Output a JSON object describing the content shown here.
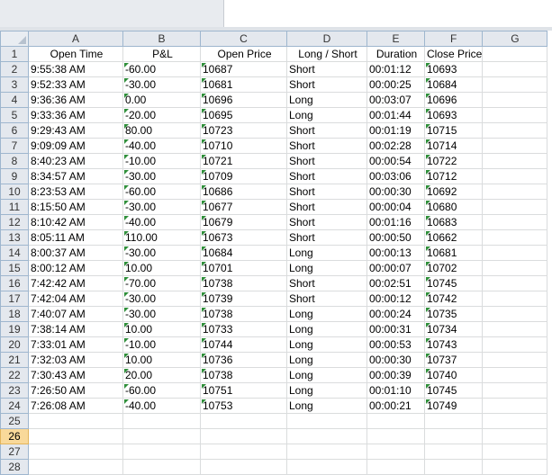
{
  "columns": [
    "A",
    "B",
    "C",
    "D",
    "E",
    "F",
    "G"
  ],
  "headers": [
    "Open Time",
    "P&L",
    "Open Price",
    "Long / Short",
    "Duration",
    "Close Price",
    ""
  ],
  "rows": [
    [
      "9:55:38 AM",
      "-60.00",
      "10687",
      "Short",
      "00:01:12",
      "10693"
    ],
    [
      "9:52:33 AM",
      "-30.00",
      "10681",
      "Short",
      "00:00:25",
      "10684"
    ],
    [
      "9:36:36 AM",
      "0.00",
      "10696",
      "Long",
      "00:03:07",
      "10696"
    ],
    [
      "9:33:36 AM",
      "-20.00",
      "10695",
      "Long",
      "00:01:44",
      "10693"
    ],
    [
      "9:29:43 AM",
      "80.00",
      "10723",
      "Short",
      "00:01:19",
      "10715"
    ],
    [
      "9:09:09 AM",
      "-40.00",
      "10710",
      "Short",
      "00:02:28",
      "10714"
    ],
    [
      "8:40:23 AM",
      "-10.00",
      "10721",
      "Short",
      "00:00:54",
      "10722"
    ],
    [
      "8:34:57 AM",
      "-30.00",
      "10709",
      "Short",
      "00:03:06",
      "10712"
    ],
    [
      "8:23:53 AM",
      "-60.00",
      "10686",
      "Short",
      "00:00:30",
      "10692"
    ],
    [
      "8:15:50 AM",
      "-30.00",
      "10677",
      "Short",
      "00:00:04",
      "10680"
    ],
    [
      "8:10:42 AM",
      "-40.00",
      "10679",
      "Short",
      "00:01:16",
      "10683"
    ],
    [
      "8:05:11 AM",
      "110.00",
      "10673",
      "Short",
      "00:00:50",
      "10662"
    ],
    [
      "8:00:37 AM",
      "-30.00",
      "10684",
      "Long",
      "00:00:13",
      "10681"
    ],
    [
      "8:00:12 AM",
      "10.00",
      "10701",
      "Long",
      "00:00:07",
      "10702"
    ],
    [
      "7:42:42 AM",
      "-70.00",
      "10738",
      "Short",
      "00:02:51",
      "10745"
    ],
    [
      "7:42:04 AM",
      "-30.00",
      "10739",
      "Short",
      "00:00:12",
      "10742"
    ],
    [
      "7:40:07 AM",
      "-30.00",
      "10738",
      "Long",
      "00:00:24",
      "10735"
    ],
    [
      "7:38:14 AM",
      "10.00",
      "10733",
      "Long",
      "00:00:31",
      "10734"
    ],
    [
      "7:33:01 AM",
      "-10.00",
      "10744",
      "Long",
      "00:00:53",
      "10743"
    ],
    [
      "7:32:03 AM",
      "10.00",
      "10736",
      "Long",
      "00:00:30",
      "10737"
    ],
    [
      "7:30:43 AM",
      "20.00",
      "10738",
      "Long",
      "00:00:39",
      "10740"
    ],
    [
      "7:26:50 AM",
      "-60.00",
      "10751",
      "Long",
      "00:01:10",
      "10745"
    ],
    [
      "7:26:08 AM",
      "-40.00",
      "10753",
      "Long",
      "00:00:21",
      "10749"
    ]
  ],
  "row_numbers": [
    "1",
    "2",
    "3",
    "4",
    "5",
    "6",
    "7",
    "8",
    "9",
    "10",
    "11",
    "12",
    "13",
    "14",
    "15",
    "16",
    "17",
    "18",
    "19",
    "20",
    "21",
    "22",
    "23",
    "24",
    "25",
    "26",
    "27",
    "28"
  ],
  "selected_row": "26",
  "colors": {
    "header_bg": "#e4e8ee",
    "selected_row_bg": "#f9d99a",
    "grid": "#dadcdd",
    "text_number_marker": "#2f8f3a"
  }
}
